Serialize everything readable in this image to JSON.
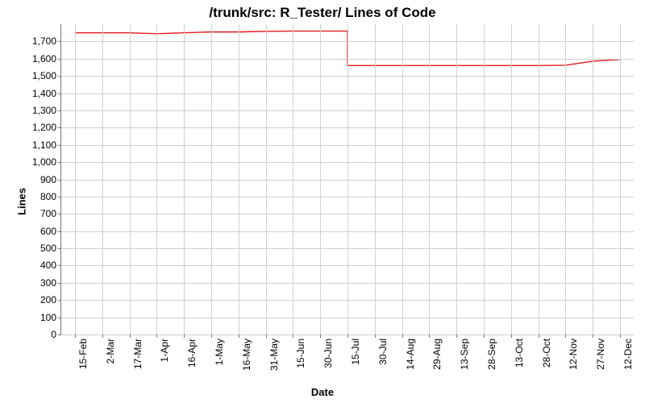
{
  "chart_data": {
    "type": "line",
    "title": "/trunk/src: R_Tester/ Lines of Code",
    "xlabel": "Date",
    "ylabel": "Lines",
    "ylim": [
      0,
      1800
    ],
    "y_ticks": [
      0,
      100,
      200,
      300,
      400,
      500,
      600,
      700,
      800,
      900,
      1000,
      1100,
      1200,
      1300,
      1400,
      1500,
      1600,
      1700
    ],
    "categories": [
      "15-Feb",
      "2-Mar",
      "17-Mar",
      "1-Apr",
      "16-Apr",
      "1-May",
      "16-May",
      "31-May",
      "15-Jun",
      "30-Jun",
      "15-Jul",
      "30-Jul",
      "14-Aug",
      "29-Aug",
      "13-Sep",
      "28-Sep",
      "13-Oct",
      "28-Oct",
      "12-Nov",
      "27-Nov",
      "12-Dec"
    ],
    "series": [
      {
        "name": "Lines of Code",
        "color": "#e41a1c",
        "values": [
          1750,
          1750,
          1750,
          1745,
          1750,
          1755,
          1755,
          1758,
          1760,
          1760,
          1560,
          1560,
          1560,
          1560,
          1560,
          1560,
          1560,
          1560,
          1562,
          1585,
          1595
        ]
      }
    ]
  }
}
